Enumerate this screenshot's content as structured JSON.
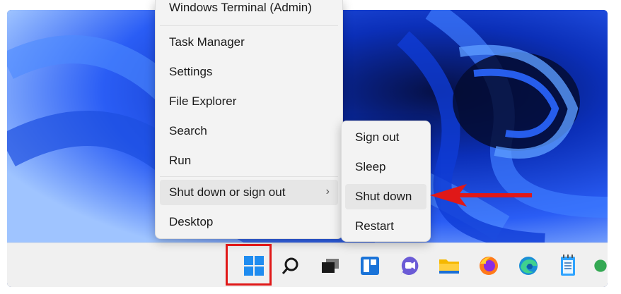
{
  "context_menu": {
    "items": [
      {
        "label": "Windows Terminal (Admin)"
      },
      {
        "label": "Task Manager"
      },
      {
        "label": "Settings"
      },
      {
        "label": "File Explorer"
      },
      {
        "label": "Search"
      },
      {
        "label": "Run"
      },
      {
        "label": "Shut down or sign out",
        "has_submenu": true
      },
      {
        "label": "Desktop"
      }
    ],
    "submenu_chevron": "›"
  },
  "shutdown_submenu": {
    "items": [
      {
        "label": "Sign out"
      },
      {
        "label": "Sleep"
      },
      {
        "label": "Shut down"
      },
      {
        "label": "Restart"
      }
    ]
  },
  "taskbar": {
    "icons": [
      "windows-start-icon",
      "search-icon",
      "task-view-icon",
      "widgets-icon",
      "chat-icon",
      "file-explorer-icon",
      "firefox-icon",
      "edge-icon",
      "notepad-icon"
    ]
  },
  "colors": {
    "highlight_red": "#e01818",
    "menu_bg": "#f3f3f3",
    "wallpaper_blue": "#0a2a8a"
  }
}
